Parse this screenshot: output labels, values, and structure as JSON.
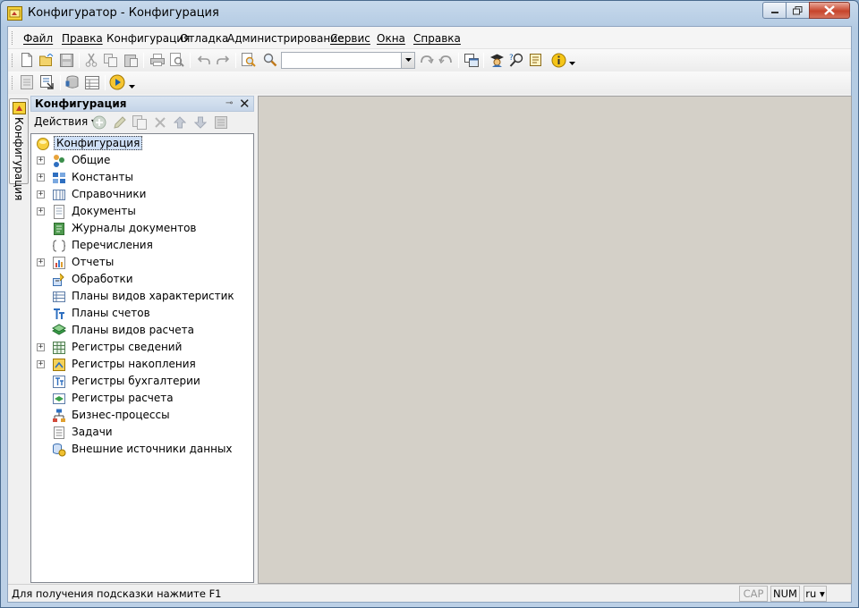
{
  "window": {
    "title": "Конфигуратор - Конфигурация"
  },
  "menu": [
    {
      "label": "Файл",
      "underline": true
    },
    {
      "label": "Правка",
      "underline": true
    },
    {
      "label": "Конфигурация",
      "underline": false
    },
    {
      "label": "Отладка",
      "underline": false
    },
    {
      "label": "Администрирование",
      "underline": false
    },
    {
      "label": "Сервис",
      "underline": true
    },
    {
      "label": "Окна",
      "underline": true
    },
    {
      "label": "Справка",
      "underline": true
    }
  ],
  "toolbar": {
    "search_value": ""
  },
  "sidetab": {
    "label": "Конфигурация"
  },
  "panel": {
    "title": "Конфигурация",
    "actions_label": "Действия ▾"
  },
  "tree": {
    "root": "Конфигурация",
    "items": [
      {
        "label": "Общие",
        "expandable": true,
        "icon": "common-icon"
      },
      {
        "label": "Константы",
        "expandable": true,
        "icon": "constants-icon"
      },
      {
        "label": "Справочники",
        "expandable": true,
        "icon": "catalogs-icon"
      },
      {
        "label": "Документы",
        "expandable": true,
        "icon": "documents-icon"
      },
      {
        "label": "Журналы документов",
        "expandable": false,
        "icon": "journals-icon"
      },
      {
        "label": "Перечисления",
        "expandable": false,
        "icon": "enums-icon"
      },
      {
        "label": "Отчеты",
        "expandable": true,
        "icon": "reports-icon"
      },
      {
        "label": "Обработки",
        "expandable": false,
        "icon": "processing-icon"
      },
      {
        "label": "Планы видов характеристик",
        "expandable": false,
        "icon": "char-types-icon"
      },
      {
        "label": "Планы счетов",
        "expandable": false,
        "icon": "chart-of-accounts-icon"
      },
      {
        "label": "Планы видов расчета",
        "expandable": false,
        "icon": "calc-types-icon"
      },
      {
        "label": "Регистры сведений",
        "expandable": true,
        "icon": "info-registers-icon"
      },
      {
        "label": "Регистры накопления",
        "expandable": true,
        "icon": "accum-registers-icon"
      },
      {
        "label": "Регистры бухгалтерии",
        "expandable": false,
        "icon": "accounting-registers-icon"
      },
      {
        "label": "Регистры расчета",
        "expandable": false,
        "icon": "calc-registers-icon"
      },
      {
        "label": "Бизнес-процессы",
        "expandable": false,
        "icon": "business-processes-icon"
      },
      {
        "label": "Задачи",
        "expandable": false,
        "icon": "tasks-icon"
      },
      {
        "label": "Внешние источники данных",
        "expandable": false,
        "icon": "external-data-icon"
      }
    ]
  },
  "status": {
    "hint": "Для получения подсказки нажмите F1",
    "cap": "CAP",
    "num": "NUM",
    "lang": "ru ▾"
  }
}
